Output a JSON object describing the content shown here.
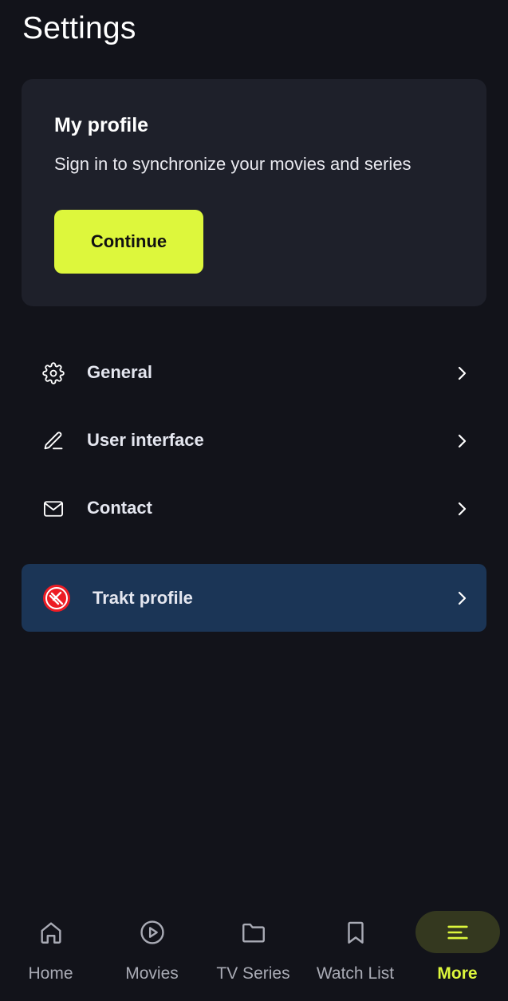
{
  "header": {
    "title": "Settings"
  },
  "profile_card": {
    "title": "My profile",
    "subtitle": "Sign in to synchronize your movies and series",
    "button_label": "Continue"
  },
  "menu": {
    "items": [
      {
        "label": "General",
        "icon": "gear-icon"
      },
      {
        "label": "User interface",
        "icon": "pen-icon"
      },
      {
        "label": "Contact",
        "icon": "envelope-icon"
      }
    ]
  },
  "trakt": {
    "label": "Trakt profile",
    "icon": "trakt-logo"
  },
  "bottom_nav": {
    "items": [
      {
        "label": "Home",
        "icon": "home-icon",
        "active": false
      },
      {
        "label": "Movies",
        "icon": "play-circle-icon",
        "active": false
      },
      {
        "label": "TV Series",
        "icon": "folder-icon",
        "active": false
      },
      {
        "label": "Watch List",
        "icon": "bookmark-icon",
        "active": false
      },
      {
        "label": "More",
        "icon": "menu-lines-icon",
        "active": true
      }
    ]
  },
  "colors": {
    "background": "#12131a",
    "card": "#1e202a",
    "accent": "#ddf73c",
    "trakt_card": "#1b3556",
    "nav_inactive": "#a9abb5"
  }
}
